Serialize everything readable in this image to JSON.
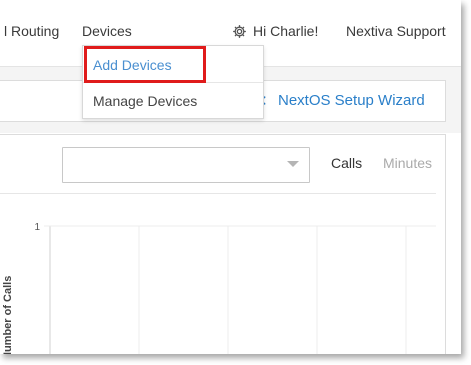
{
  "nav": {
    "routing_label": "l Routing",
    "devices_label": "Devices",
    "user_greeting": "Hi Charlie!",
    "support_label": "Nextiva Support"
  },
  "devices_menu": {
    "items": [
      {
        "label": "Add Devices",
        "highlighted": true
      },
      {
        "label": "Manage Devices",
        "highlighted": false
      }
    ]
  },
  "setup": {
    "wizard_label": "NextOS Setup Wizard"
  },
  "filters": {
    "select_value": "",
    "toggle_calls": "Calls",
    "toggle_minutes": "Minutes"
  },
  "colors": {
    "accent": "#2a7fc9",
    "highlight_border": "#e01b1b"
  },
  "chart_data": {
    "type": "line",
    "ylabel": "Number of Calls",
    "xlabel": "",
    "yticks": [
      "1"
    ],
    "series": []
  }
}
